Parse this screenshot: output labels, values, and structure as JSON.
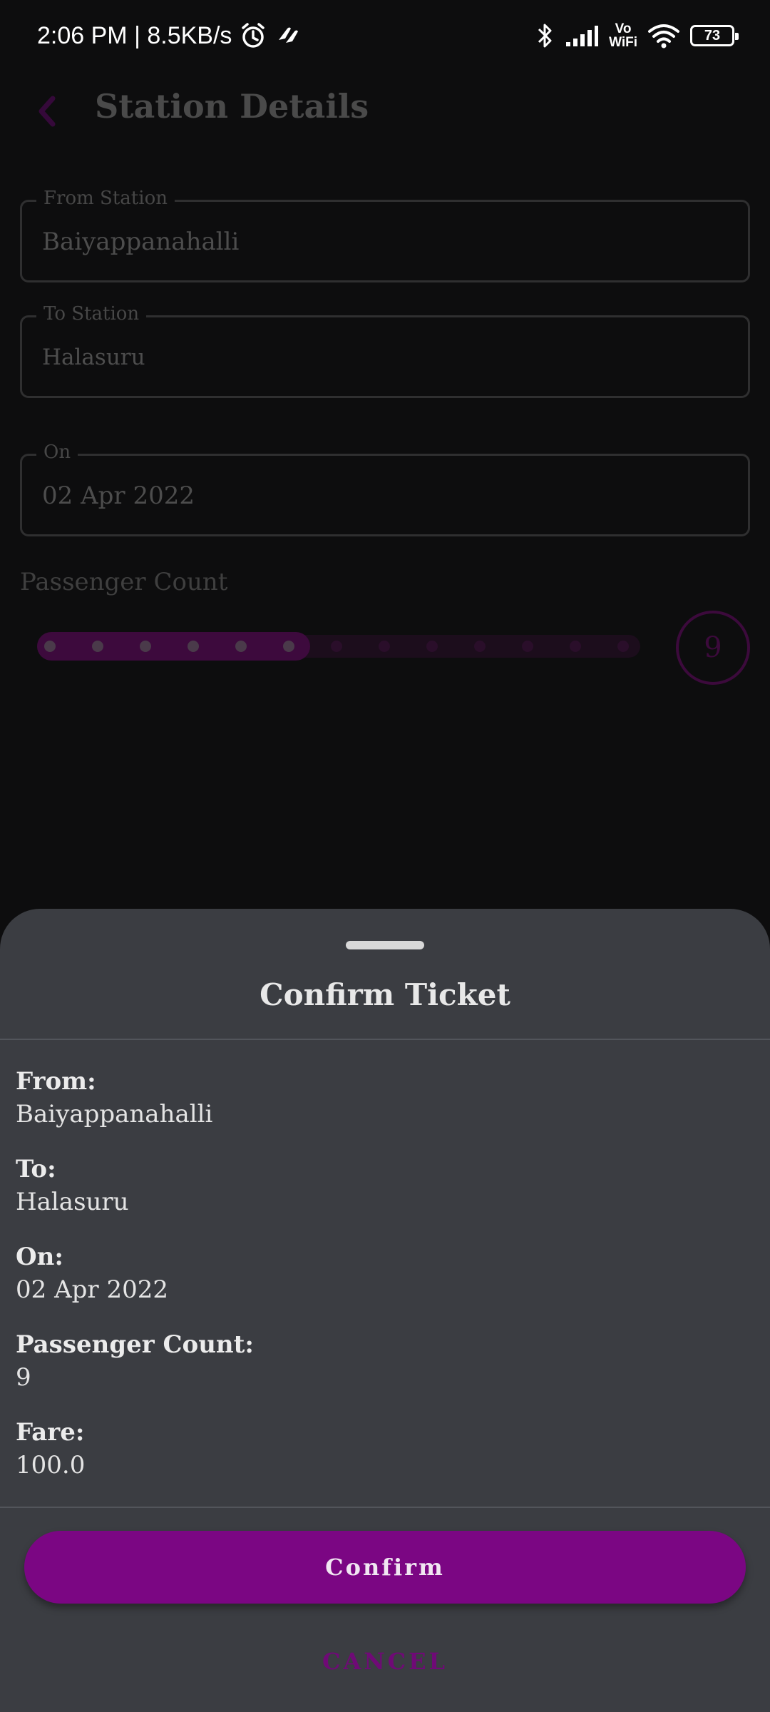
{
  "status_bar": {
    "time_speed": "2:06 PM | 8.5KB/s",
    "vowifi_top": "Vo",
    "vowifi_bottom": "WiFi",
    "battery": "73",
    "icons": [
      "alarm-icon",
      "app-notification-icon",
      "bluetooth-icon",
      "signal-icon",
      "vowifi-icon",
      "wifi-icon",
      "battery-icon"
    ]
  },
  "page": {
    "title": "Station Details",
    "from_field": {
      "label": "From Station",
      "value": "Baiyappanahalli"
    },
    "to_field": {
      "label": "To Station",
      "value": "Halasuru"
    },
    "date_field": {
      "label": "On",
      "value": "02 Apr 2022"
    },
    "passenger_label": "Passenger Count",
    "slider": {
      "value": 9,
      "min": 1,
      "max": 13,
      "active_ticks": 6,
      "total_ticks": 13
    },
    "count_badge": "9"
  },
  "sheet": {
    "title": "Confirm Ticket",
    "from_label": "From:",
    "from_value": "Baiyappanahalli",
    "to_label": "To:",
    "to_value": "Halasuru",
    "on_label": "On:",
    "on_value": "02 Apr 2022",
    "passenger_label": "Passenger Count:",
    "passenger_value": "9",
    "fare_label": "Fare:",
    "fare_value": "100.0",
    "confirm_label": "Confirm",
    "cancel_label": "CANCEL"
  },
  "colors": {
    "accent": "#7b0683",
    "sheet_bg": "#3b3d42",
    "page_bg": "#0d0d0e"
  }
}
